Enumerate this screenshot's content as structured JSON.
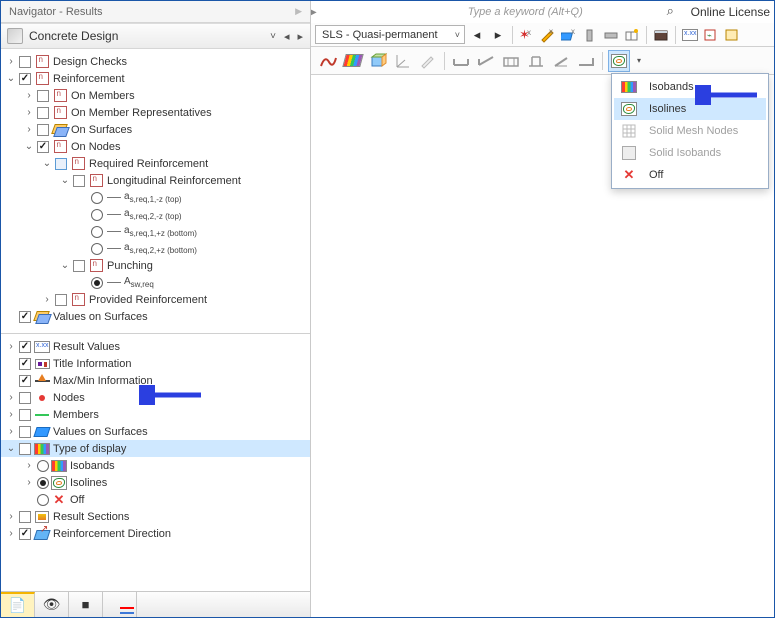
{
  "topbar": {
    "keyword_hint": "Type a keyword (Alt+Q)",
    "online": "Online License"
  },
  "navigator": {
    "title": "Navigator - Results",
    "section": "Concrete Design",
    "items": {
      "design_checks": "Design Checks",
      "reinforcement": "Reinforcement",
      "on_members": "On Members",
      "on_member_reps": "On Member Representatives",
      "on_surfaces": "On Surfaces",
      "on_nodes": "On Nodes",
      "required": "Required Reinforcement",
      "longitudinal": "Longitudinal Reinforcement",
      "a1": "a",
      "a1_sub": "s,req,1,-z (top)",
      "a2_sub": "s,req,2,-z (top)",
      "a3_sub": "s,req,1,+z (bottom)",
      "a4_sub": "s,req,2,+z (bottom)",
      "punching": "Punching",
      "asw": "A",
      "asw_sub": "sw,req",
      "provided": "Provided Reinforcement",
      "values_on_surfaces": "Values on Surfaces",
      "result_values": "Result Values",
      "title_info": "Title Information",
      "maxmin": "Max/Min Information",
      "nodes": "Nodes",
      "members": "Members",
      "values_on_surfaces2": "Values on Surfaces",
      "type_of_display": "Type of display",
      "isobands": "Isobands",
      "isolines": "Isolines",
      "off": "Off",
      "result_sections": "Result Sections",
      "rein_dir": "Reinforcement Direction"
    }
  },
  "sls": {
    "label": "SLS - Quasi-permanent"
  },
  "dropdown": {
    "isobands": "Isobands",
    "isolines": "Isolines",
    "solid_mesh": "Solid Mesh Nodes",
    "solid_iso": "Solid Isobands",
    "off": "Off"
  }
}
